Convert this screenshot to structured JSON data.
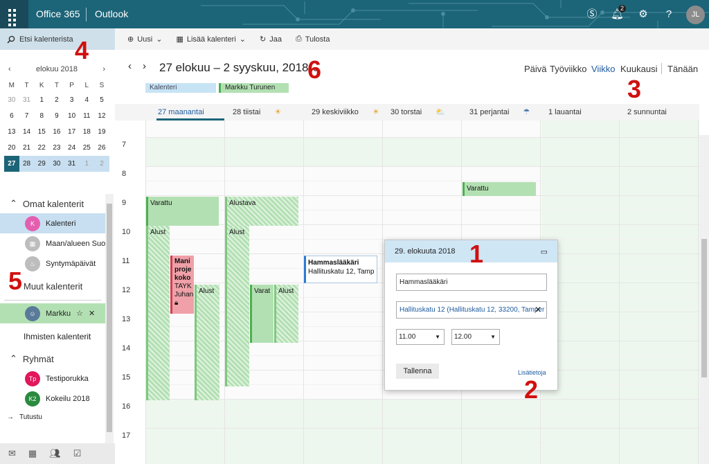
{
  "topbar": {
    "brand": "Office 365",
    "app": "Outlook",
    "notif_count": "2",
    "avatar_initials": "JL"
  },
  "search": {
    "placeholder": "Etsi kalenterista"
  },
  "commands": {
    "new": "Uusi",
    "add_calendar": "Lisää kalenteri",
    "share": "Jaa",
    "print": "Tulosta"
  },
  "mini_calendar": {
    "month": "elokuu 2018",
    "weekdays": [
      "M",
      "T",
      "K",
      "T",
      "P",
      "L",
      "S"
    ],
    "weeks": [
      [
        "30",
        "31",
        "1",
        "2",
        "3",
        "4",
        "5"
      ],
      [
        "6",
        "7",
        "8",
        "9",
        "10",
        "11",
        "12"
      ],
      [
        "13",
        "14",
        "15",
        "16",
        "17",
        "18",
        "19"
      ],
      [
        "20",
        "21",
        "22",
        "23",
        "24",
        "25",
        "26"
      ],
      [
        "27",
        "28",
        "29",
        "30",
        "31",
        "1",
        "2"
      ]
    ]
  },
  "left_panel": {
    "my_calendars": "Omat kalenterit",
    "calendars": [
      {
        "initial": "K",
        "name": "Kalenteri",
        "color": "#e35fb0"
      },
      {
        "initial": "",
        "name": "Maan/alueen Suo",
        "color": "#bdbdbd"
      },
      {
        "initial": "",
        "name": "Syntymäpäivät",
        "color": "#bdbdbd"
      }
    ],
    "other_calendars": "Muut kalenterit",
    "shared_person": "Markku",
    "people_calendars": "Ihmisten kalenterit",
    "groups_title": "Ryhmät",
    "groups": [
      {
        "initial": "Tp",
        "name": "Testiporukka",
        "color": "#e2165a"
      },
      {
        "initial": "K2",
        "name": "Kokeilu 2018",
        "color": "#2a8a3e"
      }
    ],
    "explore": "Tutustu"
  },
  "header": {
    "range": "27 elokuu – 2 syyskuu, 2018",
    "views": [
      "Päivä",
      "Työviikko",
      "Viikko",
      "Kuukausi"
    ],
    "today": "Tänään",
    "chips": [
      "Kalenteri",
      "Markku Turunen"
    ]
  },
  "days": [
    "27 maanantai",
    "28 tiistai",
    "29 keskiviikko",
    "30 torstai",
    "31 perjantai",
    "1 lauantai",
    "2 sunnuntai"
  ],
  "hours": [
    "7",
    "8",
    "9",
    "10",
    "11",
    "12",
    "13",
    "14",
    "15",
    "16",
    "17"
  ],
  "events": {
    "varattu": "Varattu",
    "alustava": "Alustava",
    "alust": "Alust",
    "alust2": "Alust",
    "varat": "Varat",
    "mani": "Mani",
    "proje": "proje",
    "koko": "koko",
    "tayk": "TAYK",
    "juhan": "Juhan",
    "hammas_title": "Hammaslääkäri",
    "hammas_loc": "Hallituskatu 12, Tamp"
  },
  "popup": {
    "date": "29. elokuuta 2018",
    "title_value": "Hammaslääkäri",
    "location_value": "Hallituskatu 12 (Hallituskatu 12, 33200, Tamper",
    "start": "11.00",
    "end": "12.00",
    "save": "Tallenna",
    "more": "Lisätietoja"
  },
  "annotations": [
    "1",
    "2",
    "3",
    "4",
    "5",
    "6"
  ]
}
